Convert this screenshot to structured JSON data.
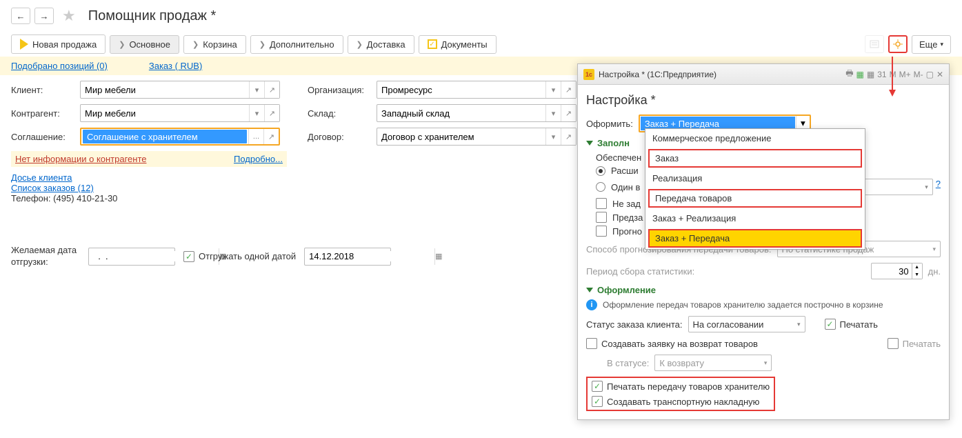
{
  "nav": {
    "back": "←",
    "forward": "→"
  },
  "page_title": "Помощник продаж *",
  "tabs": {
    "new_sale": "Новая продажа",
    "main": "Основное",
    "cart": "Корзина",
    "extra": "Дополнительно",
    "delivery": "Доставка",
    "documents": "Документы",
    "more": "Еще"
  },
  "yellow": {
    "positions": "Подобрано позиций (0)",
    "order": "Заказ ( RUB)"
  },
  "form": {
    "client_label": "Клиент:",
    "client_value": "Мир мебели",
    "counterparty_label": "Контрагент:",
    "counterparty_value": "Мир мебели",
    "agreement_label": "Соглашение:",
    "agreement_value": "Соглашение с хранителем",
    "org_label": "Организация:",
    "org_value": "Промресурс",
    "warehouse_label": "Склад:",
    "warehouse_value": "Западный склад",
    "contract_label": "Договор:",
    "contract_value": "Договор с хранителем"
  },
  "warning": {
    "text": "Нет информации о контрагенте",
    "more": "Подробно..."
  },
  "links": {
    "dossier": "Досье клиента",
    "orders": "Список заказов (12)",
    "phone_label": "Телефон:",
    "phone_value": "(495) 410-21-30"
  },
  "dates": {
    "desired_label": "Желаемая дата отгрузки:",
    "desired_value": "  .  .    ",
    "ship_one_label": "Отгружать одной датой",
    "ship_date": "14.12.2018"
  },
  "panel": {
    "header": "Настройка * (1С:Предприятие)",
    "title": "Настройка *",
    "format_label": "Оформить:",
    "format_value": "Заказ + Передача",
    "fill_section": "Заполн",
    "provision_label": "Обеспечен",
    "radio_ext": "Расши",
    "radio_one": "Один в",
    "cb_noset": "Не зад",
    "cb_pred": "Предза",
    "cb_prog": "Прогно",
    "forecast_label": "Способ прогнозирования передачи товаров:",
    "forecast_value": "По статистике продаж",
    "period_label": "Период сбора статистики:",
    "period_value": "30",
    "period_unit": "дн.",
    "design_section": "Оформление",
    "info_text": "Оформление передач товаров хранителю задается построчно в корзине",
    "status_label": "Статус заказа клиента:",
    "status_value": "На согласовании",
    "print_label": "Печатать",
    "return_label": "Создавать заявку на возврат товаров",
    "instatus_label": "В статусе:",
    "instatus_value": "К возврату",
    "print2_label": "Печатать",
    "print_transfer": "Печатать передачу товаров хранителю",
    "create_waybill": "Создавать транспортную накладную"
  },
  "dropdown_items": {
    "i1": "Коммерческое предложение",
    "i2": "Заказ",
    "i3": "Реализация",
    "i4": "Передача товаров",
    "i5": "Заказ + Реализация",
    "i6": "Заказ + Передача"
  }
}
